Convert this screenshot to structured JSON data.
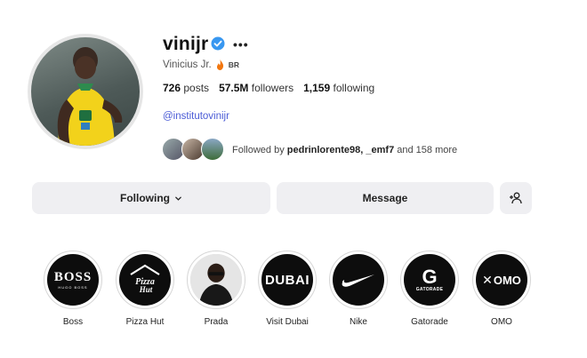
{
  "profile": {
    "username": "vinijr",
    "full_name": "Vinicius Jr.",
    "country_badge": "BR",
    "stats": {
      "posts_value": "726",
      "posts_label": "posts",
      "followers_value": "57.5M",
      "followers_label": "followers",
      "following_value": "1,159",
      "following_label": "following"
    },
    "bio_link": "@institutovinijr",
    "followed_by": {
      "prefix": "Followed by",
      "names": "pedrinlorente98, _emf7",
      "suffix": "and 158 more"
    }
  },
  "buttons": {
    "following": "Following",
    "message": "Message"
  },
  "highlights": [
    {
      "label": "Boss",
      "logo": "BOSS",
      "sub": "HUGO BOSS"
    },
    {
      "label": "Pizza Hut",
      "logo": "Pizza Hut"
    },
    {
      "label": "Prada",
      "logo": ""
    },
    {
      "label": "Visit Dubai",
      "logo": "DUBAI"
    },
    {
      "label": "Nike",
      "logo": ""
    },
    {
      "label": "Gatorade",
      "logo": "GATORADE"
    },
    {
      "label": "OMO",
      "logo": "OMO"
    }
  ],
  "colors": {
    "verified": "#3897f0",
    "link": "#4a5bd6",
    "button_bg": "#efeff2",
    "highlight_bg": "#0d0d0d"
  },
  "icons": {
    "verified": "verified-badge-icon",
    "more": "more-options-icon",
    "chevron": "chevron-down-icon",
    "add_user": "add-user-icon"
  }
}
